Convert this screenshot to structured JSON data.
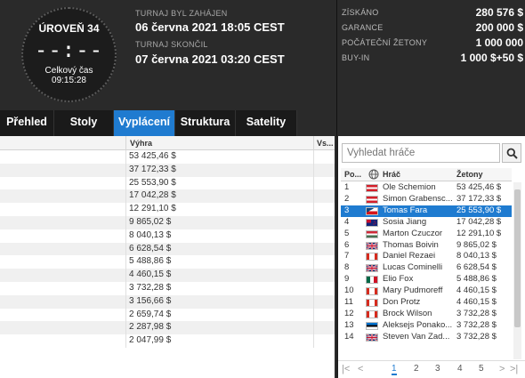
{
  "clock": {
    "level": "ÚROVEŇ 34",
    "time": "--:--",
    "total_label": "Celkový čas",
    "total_time": "09:15:28"
  },
  "tournament": {
    "started_label": "TURNAJ BYL ZAHÁJEN",
    "started_value": "06 června 2021   18:05 CEST",
    "ended_label": "TURNAJ SKONČIL",
    "ended_value": "07 června 2021   03:20 CEST"
  },
  "stats": [
    {
      "label": "ZÍSKÁNO",
      "value": "280 576 $"
    },
    {
      "label": "GARANCE",
      "value": "200 000 $"
    },
    {
      "label": "POČÁTEČNÍ ŽETONY",
      "value": "1 000 000"
    },
    {
      "label": "BUY-IN",
      "value": "1 000 $+50 $"
    }
  ],
  "tabs": [
    "Přehled",
    "Stoly",
    "Vyplácení",
    "Struktura",
    "Satelity"
  ],
  "active_tab": "Vyplácení",
  "payout": {
    "col_win": "Výhra",
    "col_vs": "Vs...",
    "values": [
      "53 425,46 $",
      "37 172,33 $",
      "25 553,90 $",
      "17 042,28 $",
      "12 291,10 $",
      "9 865,02 $",
      "8 040,13 $",
      "6 628,54 $",
      "5 488,86 $",
      "4 460,15 $",
      "3 732,28 $",
      "3 156,66 $",
      "2 659,74 $",
      "2 287,98 $",
      "2 047,99 $"
    ]
  },
  "players": {
    "search_placeholder": "Vyhledat hráče",
    "col_pos": "Po...",
    "col_player": "Hráč",
    "col_chips": "Žetony",
    "rows": [
      {
        "pos": "1",
        "name": "Ole Schemion",
        "chips": "53 425,46 $",
        "flag": "austria"
      },
      {
        "pos": "2",
        "name": "Simon Grabensc...",
        "chips": "37 172,33 $",
        "flag": "austria"
      },
      {
        "pos": "3",
        "name": "Tomas Fara",
        "chips": "25 553,90 $",
        "flag": "czech"
      },
      {
        "pos": "4",
        "name": "Sosia Jiang",
        "chips": "17 042,28 $",
        "flag": "new-zealand"
      },
      {
        "pos": "5",
        "name": "Marton Czuczor",
        "chips": "12 291,10 $",
        "flag": "hungary"
      },
      {
        "pos": "6",
        "name": "Thomas Boivin",
        "chips": "9 865,02 $",
        "flag": "uk"
      },
      {
        "pos": "7",
        "name": "Daniel Rezaei",
        "chips": "8 040,13 $",
        "flag": "canada"
      },
      {
        "pos": "8",
        "name": "Lucas Cominelli",
        "chips": "6 628,54 $",
        "flag": "uk"
      },
      {
        "pos": "9",
        "name": "Elio Fox",
        "chips": "5 488,86 $",
        "flag": "mexico"
      },
      {
        "pos": "10",
        "name": "Mary Pudmoreff",
        "chips": "4 460,15 $",
        "flag": "canada"
      },
      {
        "pos": "11",
        "name": "Don Protz",
        "chips": "4 460,15 $",
        "flag": "canada"
      },
      {
        "pos": "12",
        "name": "Brock Wilson",
        "chips": "3 732,28 $",
        "flag": "canada"
      },
      {
        "pos": "13",
        "name": "Aleksejs Ponako...",
        "chips": "3 732,28 $",
        "flag": "estonia"
      },
      {
        "pos": "14",
        "name": "Steven Van Zad...",
        "chips": "3 732,28 $",
        "flag": "uk"
      }
    ],
    "selected_pos": "3"
  },
  "pager": {
    "first": "|<",
    "prev": "<",
    "pages": [
      "1",
      "2",
      "3",
      "4",
      "5"
    ],
    "active_page": "1",
    "next": ">",
    "last": ">|"
  },
  "colors": {
    "accent": "#1f7bd0",
    "header_bg": "#2a2a2a",
    "selected_row": "#1f7bd0"
  }
}
